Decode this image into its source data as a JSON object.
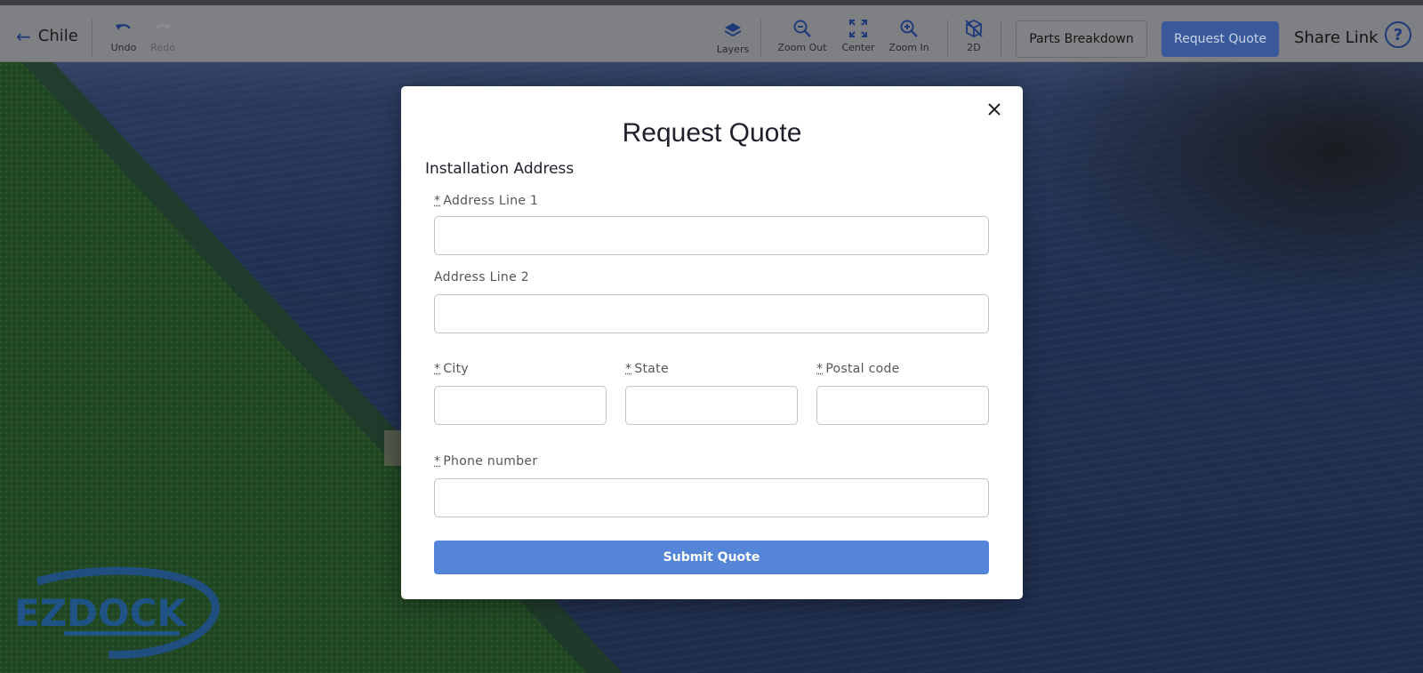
{
  "header": {
    "back_label": "Chile",
    "undo_label": "Undo",
    "redo_label": "Redo",
    "layers_label": "Layers",
    "zoom_out_label": "Zoom Out",
    "center_label": "Center",
    "zoom_in_label": "Zoom In",
    "view_2d_label": "2D",
    "parts_breakdown_label": "Parts Breakdown",
    "request_quote_label": "Request Quote",
    "share_link_label": "Share Link",
    "help_glyph": "?"
  },
  "logo": {
    "text": "EZDOCK"
  },
  "modal": {
    "title": "Request Quote",
    "section_title": "Installation Address",
    "required_mark": "*",
    "fields": {
      "address1": {
        "label": "Address Line 1",
        "value": ""
      },
      "address2": {
        "label": "Address Line 2",
        "value": ""
      },
      "city": {
        "label": "City",
        "value": ""
      },
      "state": {
        "label": "State",
        "value": ""
      },
      "postal": {
        "label": "Postal code",
        "value": ""
      },
      "phone": {
        "label": "Phone number",
        "value": ""
      }
    },
    "submit_label": "Submit Quote"
  },
  "colors": {
    "primary": "#5485d6",
    "topbar": "#7f8083",
    "accent_dark": "#1f3a7a"
  }
}
